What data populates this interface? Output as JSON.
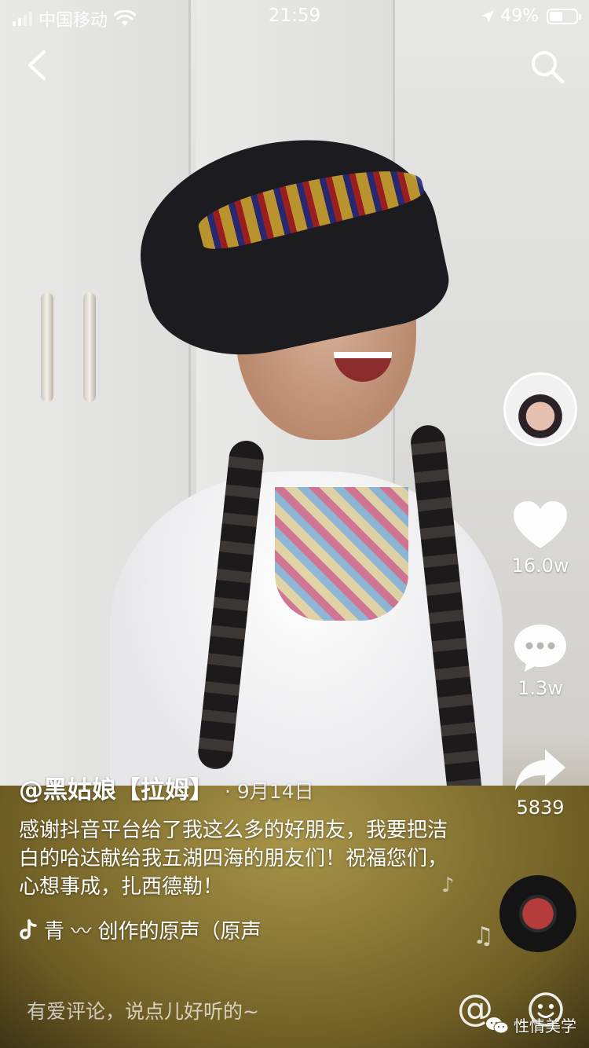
{
  "status_bar": {
    "carrier": "中国移动",
    "time": "21:59",
    "battery_percent": "49%",
    "battery_level": 0.49
  },
  "video": {
    "author": "@黑姑娘【拉姆】",
    "date": "· 9月14日",
    "caption": "感谢抖音平台给了我这么多的好朋友，我要把洁白的哈达献给我五湖四海的朋友们！祝福您们，心想事成，扎西德勒！",
    "music": "青 〰 创作的原声（原声"
  },
  "actions": {
    "likes": "16.0w",
    "comments": "1.3w",
    "shares": "5839"
  },
  "comment_bar": {
    "placeholder": "有爱评论，说点儿好听的~",
    "at_symbol": "@"
  },
  "watermark": {
    "text": "性情美学"
  }
}
